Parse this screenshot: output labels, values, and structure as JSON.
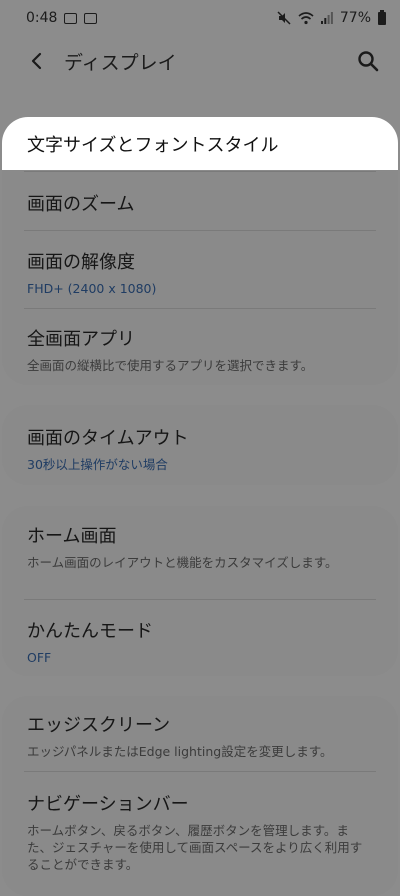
{
  "status_bar": {
    "time": "0:48",
    "battery": "77%"
  },
  "app_bar": {
    "title": "ディスプレイ",
    "back_icon": "back-chevron-icon",
    "search_icon": "search-icon"
  },
  "colors": {
    "overlay_background": "#8c8c8c",
    "card_background": "#8a8a8a",
    "highlight_background": "#ffffff",
    "accent_text": "#1f3c63"
  },
  "settings": {
    "font_style": {
      "title": "文字サイズとフォントスタイル"
    },
    "screen_zoom": {
      "title": "画面のズーム"
    },
    "resolution": {
      "title": "画面の解像度",
      "value": "FHD+ (2400 x 1080)"
    },
    "fullscreen_apps": {
      "title": "全画面アプリ",
      "description": "全画面の縦横比で使用するアプリを選択できます。"
    },
    "screen_timeout": {
      "title": "画面のタイムアウト",
      "value": "30秒以上操作がない場合"
    },
    "home_screen": {
      "title": "ホーム画面",
      "description": "ホーム画面のレイアウトと機能をカスタマイズします。"
    },
    "easy_mode": {
      "title": "かんたんモード",
      "value": "OFF"
    },
    "edge_screen": {
      "title": "エッジスクリーン",
      "description": "エッジパネルまたはEdge lighting設定を変更します。"
    },
    "navigation_bar": {
      "title": "ナビゲーションバー",
      "description": "ホームボタン、戻るボタン、履歴ボタンを管理します。また、ジェスチャーを使用して画面スペースをより広く利用することができます。"
    }
  }
}
